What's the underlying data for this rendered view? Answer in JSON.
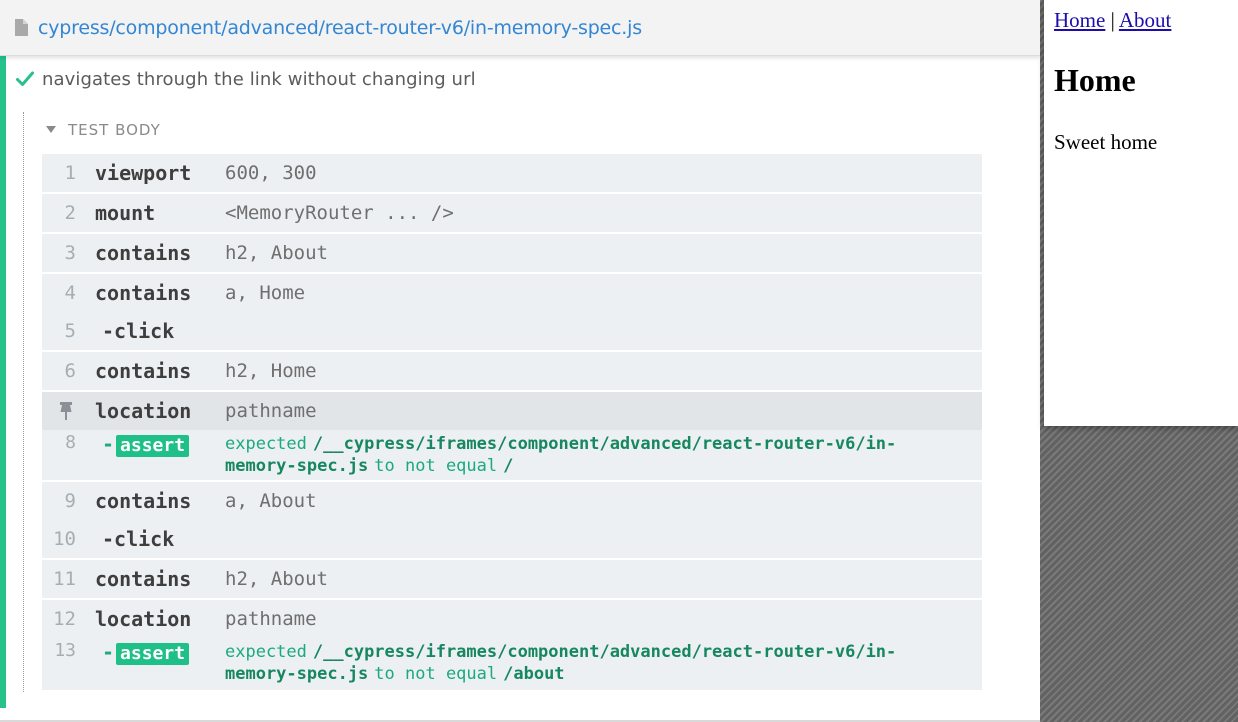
{
  "spec": {
    "path": "cypress/component/advanced/react-router-v6/in-memory-spec.js"
  },
  "test": {
    "title": "navigates through the link without changing url",
    "section_label": "TEST BODY"
  },
  "commands": [
    {
      "num": "1",
      "name": "viewport",
      "message": "600, 300"
    },
    {
      "num": "2",
      "name": "mount",
      "message": "<MemoryRouter ... />"
    },
    {
      "num": "3",
      "name": "contains",
      "message": "h2, About"
    },
    {
      "num": "4",
      "name": "contains",
      "message": "a, Home"
    },
    {
      "num": "5",
      "name": "-click",
      "message": ""
    },
    {
      "num": "6",
      "name": "contains",
      "message": "h2, Home"
    },
    {
      "num": "7",
      "name": "location",
      "message": "pathname",
      "pinned": true
    },
    {
      "num": "8",
      "name": "assert",
      "expected_word": "expected",
      "actual": "/__cypress/iframes/component/advanced/react-router-v6/in-",
      "actual_cont": "memory-spec.js",
      "relation": "to not equal",
      "expected_value": "/"
    },
    {
      "num": "9",
      "name": "contains",
      "message": "a, About"
    },
    {
      "num": "10",
      "name": "-click",
      "message": ""
    },
    {
      "num": "11",
      "name": "contains",
      "message": "h2, About"
    },
    {
      "num": "12",
      "name": "location",
      "message": "pathname"
    },
    {
      "num": "13",
      "name": "assert",
      "expected_word": "expected",
      "actual": "/__cypress/iframes/component/advanced/react-router-v6/in-",
      "actual_cont": "memory-spec.js",
      "relation": "to not equal",
      "expected_value": "/about"
    }
  ],
  "aut": {
    "nav_home": "Home",
    "nav_separator": "|",
    "nav_about": "About",
    "heading": "Home",
    "text": "Sweet home"
  },
  "colors": {
    "pass": "#27c18b",
    "link": "#3386d4",
    "badge": "#1fbf88"
  }
}
